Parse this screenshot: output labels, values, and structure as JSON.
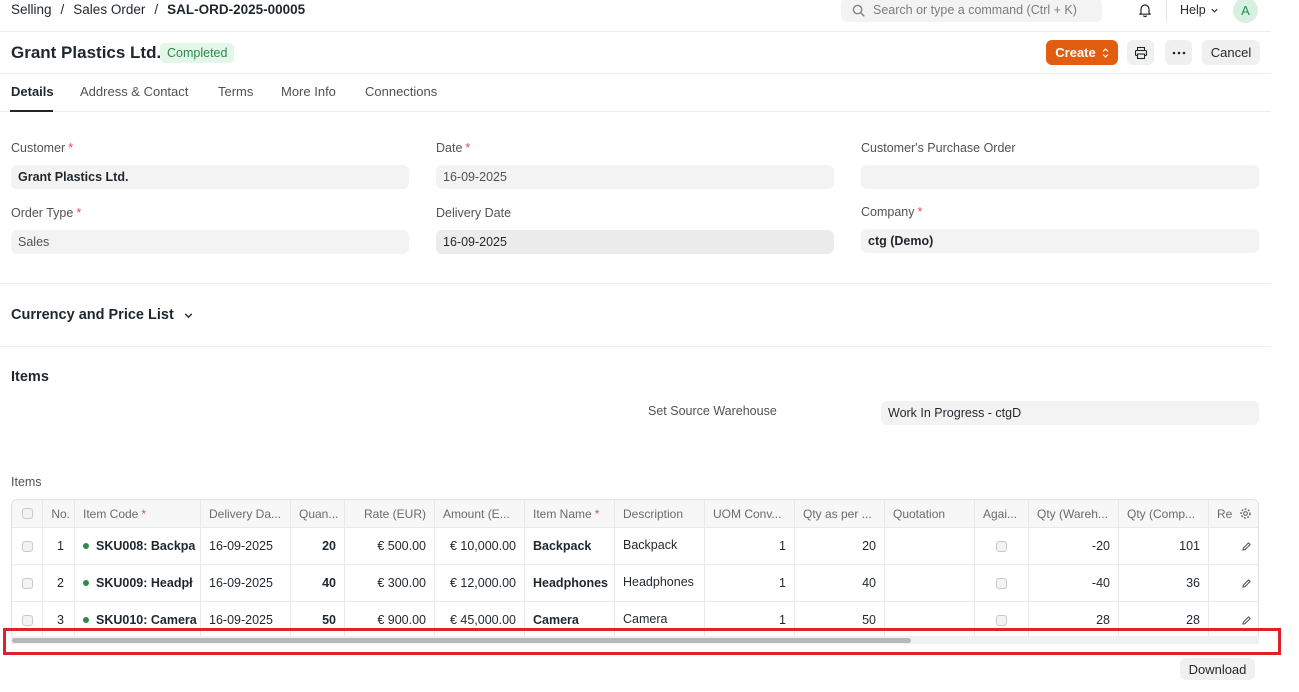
{
  "breadcrumb": [
    "Selling",
    "Sales Order",
    "SAL-ORD-2025-00005"
  ],
  "search": {
    "placeholder": "Search or type a command (Ctrl + K)"
  },
  "navbar": {
    "help_label": "Help",
    "avatar_initial": "A"
  },
  "page": {
    "title": "Grant Plastics Ltd.",
    "status": "Completed",
    "create_label": "Create",
    "cancel_label": "Cancel"
  },
  "tabs": [
    "Details",
    "Address & Contact",
    "Terms",
    "More Info",
    "Connections"
  ],
  "fields": {
    "customer": {
      "label": "Customer",
      "value": "Grant Plastics Ltd."
    },
    "date": {
      "label": "Date",
      "value": "16-09-2025"
    },
    "customer_po": {
      "label": "Customer's Purchase Order",
      "value": ""
    },
    "order_type": {
      "label": "Order Type",
      "value": "Sales"
    },
    "delivery_date": {
      "label": "Delivery Date",
      "value": "16-09-2025"
    },
    "company": {
      "label": "Company",
      "value": "ctg (Demo)"
    }
  },
  "sections": {
    "currency": "Currency and Price List",
    "items": "Items",
    "items_table_label": "Items"
  },
  "source_warehouse": {
    "label": "Set Source Warehouse",
    "value": "Work In Progress - ctgD"
  },
  "grid": {
    "headers": [
      "No.",
      "Item Code",
      "Delivery Da...",
      "Quan...",
      "Rate (EUR)",
      "Amount (E...",
      "Item Name",
      "Description",
      "UOM Conv...",
      "Qty as per ...",
      "Quotation",
      "Agai...",
      "Qty (Wareh...",
      "Qty (Comp...",
      "Re"
    ],
    "rows": [
      {
        "no": "1",
        "item_code": "SKU008: Backpa",
        "delivery": "16-09-2025",
        "qty": "20",
        "rate": "€ 500.00",
        "amount": "€ 10,000.00",
        "item_name": "Backpack",
        "description": "Backpack",
        "uom": "1",
        "qty_per": "20",
        "quotation": "",
        "qty_wh": "-20",
        "qty_comp": "101"
      },
      {
        "no": "2",
        "item_code": "SKU009: Headpł",
        "delivery": "16-09-2025",
        "qty": "40",
        "rate": "€ 300.00",
        "amount": "€ 12,000.00",
        "item_name": "Headphones",
        "description": "Headphones",
        "uom": "1",
        "qty_per": "40",
        "quotation": "",
        "qty_wh": "-40",
        "qty_comp": "36"
      },
      {
        "no": "3",
        "item_code": "SKU010: Camera",
        "delivery": "16-09-2025",
        "qty": "50",
        "rate": "€ 900.00",
        "amount": "€ 45,000.00",
        "item_name": "Camera",
        "description": "Camera",
        "uom": "1",
        "qty_per": "50",
        "quotation": "",
        "qty_wh": "28",
        "qty_comp": "28"
      }
    ]
  },
  "download_label": "Download",
  "colors": {
    "primary": "#e25d10",
    "success": "#2d8a4c",
    "highlight": "#e0202a"
  }
}
